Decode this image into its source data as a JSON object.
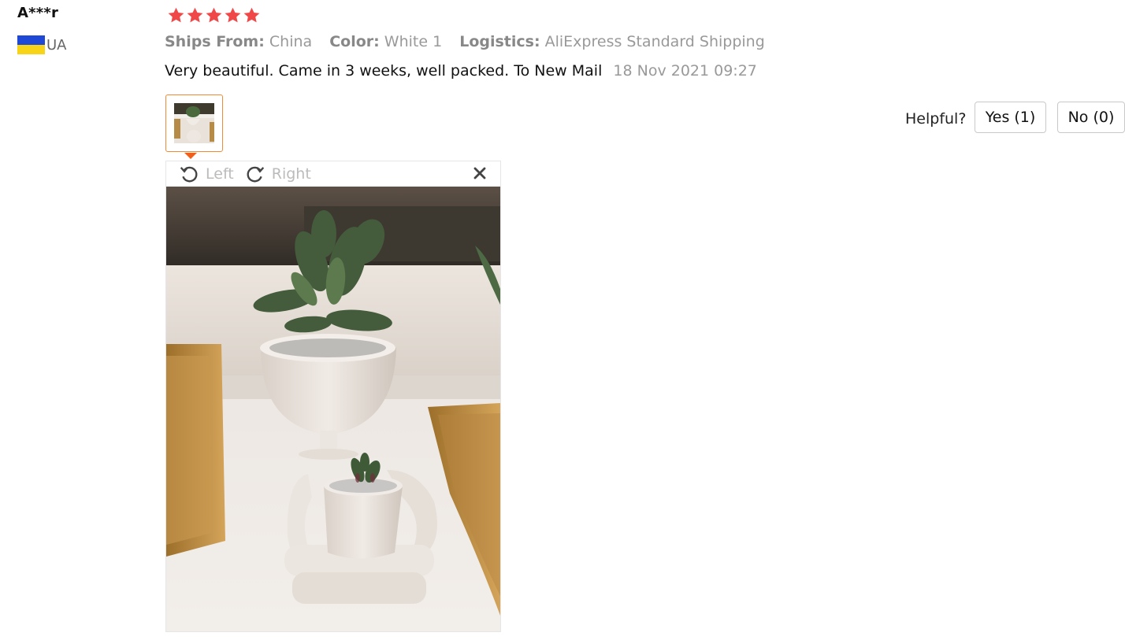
{
  "review": {
    "user_name": "A***r",
    "country_code": "UA",
    "rating": 5,
    "ships_from_label": "Ships From:",
    "ships_from_value": "China",
    "color_label": "Color:",
    "color_value": "White 1",
    "logistics_label": "Logistics:",
    "logistics_value": "AliExpress Standard Shipping",
    "text": "Very beautiful. Came in 3 weeks, well packed. To New Mail",
    "date": "18 Nov 2021 09:27"
  },
  "viewer": {
    "rotate_left_label": "Left",
    "rotate_right_label": "Right"
  },
  "helpful": {
    "label": "Helpful?",
    "yes_label": "Yes (1)",
    "no_label": "No (0)"
  },
  "colors": {
    "star": "#f04848",
    "thumb_border": "#f48a34",
    "flag_blue": "#1f48d6",
    "flag_yellow": "#f7d417"
  },
  "icons": [
    "star-icon",
    "ukraine-flag-icon",
    "rotate-left-icon",
    "rotate-right-icon",
    "close-icon"
  ]
}
